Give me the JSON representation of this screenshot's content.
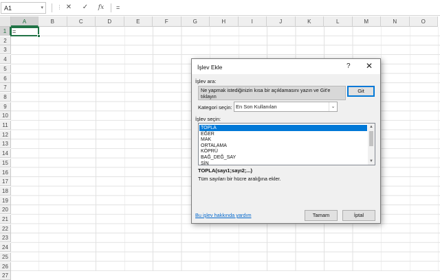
{
  "formula_bar": {
    "name_box": "A1",
    "name_box_arrow": "▾",
    "dots": "⋮",
    "cancel_icon": "✕",
    "enter_icon": "✓",
    "fx_label": "fx",
    "formula": "="
  },
  "sheet": {
    "columns": [
      "A",
      "B",
      "C",
      "D",
      "E",
      "F",
      "G",
      "H",
      "I",
      "J",
      "K",
      "L",
      "M",
      "N",
      "O"
    ],
    "rows": [
      "1",
      "2",
      "3",
      "4",
      "5",
      "6",
      "7",
      "8",
      "9",
      "10",
      "11",
      "12",
      "13",
      "14",
      "15",
      "16",
      "17",
      "18",
      "19",
      "20",
      "21",
      "22",
      "23",
      "24",
      "25",
      "26",
      "27"
    ],
    "selected_column": "A",
    "selected_row": "1",
    "active_cell_value": "="
  },
  "dialog": {
    "title": "İşlev Ekle",
    "help_icon": "?",
    "close_icon": "✕",
    "search_label": "İşlev ara:",
    "search_value": "Ne yapmak istediğinizin kısa bir açıklamasını yazın ve Git'e tıklayın",
    "go_button": "Git",
    "category_label": "Kategori seçin:",
    "category_value": "En Son Kullanılan",
    "category_arrow": "⌄",
    "function_label": "İşlev seçin:",
    "functions": [
      "TOPLA",
      "EĞER",
      "MAK",
      "ORTALAMA",
      "KÖPRÜ",
      "BAĞ_DEĞ_SAY",
      "SİN"
    ],
    "selected_function": "TOPLA",
    "scroll_up": "▲",
    "scroll_down": "▼",
    "syntax": "TOPLA(sayı1;sayı2;...)",
    "description": "Tüm sayıları bir hücre aralığına ekler.",
    "help_link": "Bu işlev hakkında yardım",
    "ok_button": "Tamam",
    "cancel_button": "İptal",
    "accent_color": "#0078d7"
  }
}
